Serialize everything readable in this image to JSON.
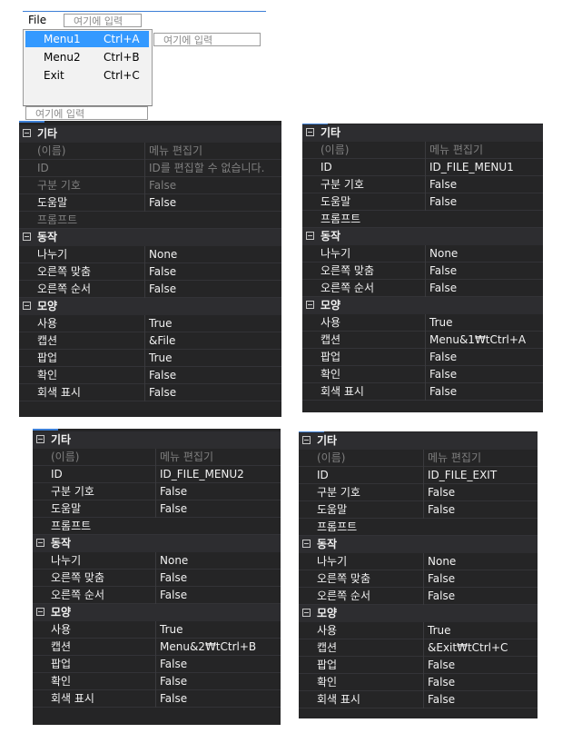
{
  "menu_editor": {
    "menubar_file": "File",
    "placeholder": "여기에 입력",
    "items": [
      {
        "label": "Menu1",
        "accel": "Ctrl+A"
      },
      {
        "label": "Menu2",
        "accel": "Ctrl+B"
      },
      {
        "label": "Exit",
        "accel": "Ctrl+C"
      }
    ]
  },
  "panels": [
    {
      "categories": [
        {
          "name": "기타",
          "props": [
            {
              "name": "(이름)",
              "value": "메뉴 편집기",
              "dim": true
            },
            {
              "name": "ID",
              "value": "ID를 편집할 수 없습니다.",
              "dim": true
            },
            {
              "name": "구분 기호",
              "value": "False",
              "dim": true
            },
            {
              "name": "도움말",
              "value": "False",
              "dim": false
            },
            {
              "name": "프롬프트",
              "value": "",
              "dim": true
            }
          ]
        },
        {
          "name": "동작",
          "props": [
            {
              "name": "나누기",
              "value": "None",
              "dim": false
            },
            {
              "name": "오른쪽 맞춤",
              "value": "False",
              "dim": false
            },
            {
              "name": "오른쪽 순서",
              "value": "False",
              "dim": false
            }
          ]
        },
        {
          "name": "모양",
          "props": [
            {
              "name": "사용",
              "value": "True",
              "dim": false
            },
            {
              "name": "캡션",
              "value": "&File",
              "dim": false
            },
            {
              "name": "팝업",
              "value": "True",
              "dim": false
            },
            {
              "name": "확인",
              "value": "False",
              "dim": false
            },
            {
              "name": "회색 표시",
              "value": "False",
              "dim": false
            }
          ]
        }
      ]
    },
    {
      "categories": [
        {
          "name": "기타",
          "props": [
            {
              "name": "(이름)",
              "value": "메뉴 편집기",
              "dim": true
            },
            {
              "name": "ID",
              "value": "ID_FILE_MENU1",
              "dim": false
            },
            {
              "name": "구분 기호",
              "value": "False",
              "dim": false
            },
            {
              "name": "도움말",
              "value": "False",
              "dim": false
            },
            {
              "name": "프롬프트",
              "value": "",
              "dim": false
            }
          ]
        },
        {
          "name": "동작",
          "props": [
            {
              "name": "나누기",
              "value": "None",
              "dim": false
            },
            {
              "name": "오른쪽 맞춤",
              "value": "False",
              "dim": false
            },
            {
              "name": "오른쪽 순서",
              "value": "False",
              "dim": false
            }
          ]
        },
        {
          "name": "모양",
          "props": [
            {
              "name": "사용",
              "value": "True",
              "dim": false
            },
            {
              "name": "캡션",
              "value": "Menu&1₩tCtrl+A",
              "dim": false
            },
            {
              "name": "팝업",
              "value": "False",
              "dim": false
            },
            {
              "name": "확인",
              "value": "False",
              "dim": false
            },
            {
              "name": "회색 표시",
              "value": "False",
              "dim": false
            }
          ]
        }
      ]
    },
    {
      "categories": [
        {
          "name": "기타",
          "props": [
            {
              "name": "(이름)",
              "value": "메뉴 편집기",
              "dim": true
            },
            {
              "name": "ID",
              "value": "ID_FILE_MENU2",
              "dim": false
            },
            {
              "name": "구분 기호",
              "value": "False",
              "dim": false
            },
            {
              "name": "도움말",
              "value": "False",
              "dim": false
            },
            {
              "name": "프롬프트",
              "value": "",
              "dim": false
            }
          ]
        },
        {
          "name": "동작",
          "props": [
            {
              "name": "나누기",
              "value": "None",
              "dim": false
            },
            {
              "name": "오른쪽 맞춤",
              "value": "False",
              "dim": false
            },
            {
              "name": "오른쪽 순서",
              "value": "False",
              "dim": false
            }
          ]
        },
        {
          "name": "모양",
          "props": [
            {
              "name": "사용",
              "value": "True",
              "dim": false
            },
            {
              "name": "캡션",
              "value": "Menu&2₩tCtrl+B",
              "dim": false
            },
            {
              "name": "팝업",
              "value": "False",
              "dim": false
            },
            {
              "name": "확인",
              "value": "False",
              "dim": false
            },
            {
              "name": "회색 표시",
              "value": "False",
              "dim": false
            }
          ]
        }
      ]
    },
    {
      "categories": [
        {
          "name": "기타",
          "props": [
            {
              "name": "(이름)",
              "value": "메뉴 편집기",
              "dim": true
            },
            {
              "name": "ID",
              "value": "ID_FILE_EXIT",
              "dim": false
            },
            {
              "name": "구분 기호",
              "value": "False",
              "dim": false
            },
            {
              "name": "도움말",
              "value": "False",
              "dim": false
            },
            {
              "name": "프롬프트",
              "value": "",
              "dim": false
            }
          ]
        },
        {
          "name": "동작",
          "props": [
            {
              "name": "나누기",
              "value": "None",
              "dim": false
            },
            {
              "name": "오른쪽 맞춤",
              "value": "False",
              "dim": false
            },
            {
              "name": "오른쪽 순서",
              "value": "False",
              "dim": false
            }
          ]
        },
        {
          "name": "모양",
          "props": [
            {
              "name": "사용",
              "value": "True",
              "dim": false
            },
            {
              "name": "캡션",
              "value": "&Exit₩tCtrl+C",
              "dim": false
            },
            {
              "name": "팝업",
              "value": "False",
              "dim": false
            },
            {
              "name": "확인",
              "value": "False",
              "dim": false
            },
            {
              "name": "회색 표시",
              "value": "False",
              "dim": false
            }
          ]
        }
      ]
    }
  ]
}
